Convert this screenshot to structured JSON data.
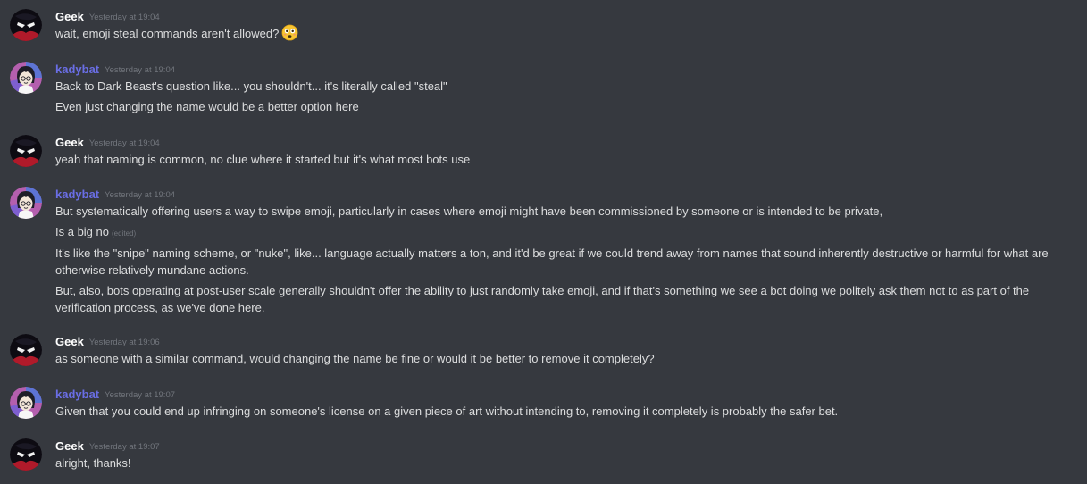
{
  "messages": [
    {
      "author": "Geek",
      "timestamp": "Yesterday at 19:04",
      "lines": [
        {
          "text": "wait, emoji steal commands aren't allowed?",
          "emoji": "flushed-face-emoji"
        }
      ]
    },
    {
      "author": "kadybat",
      "timestamp": "Yesterday at 19:04",
      "lines": [
        {
          "text": "Back to Dark Beast's question like... you shouldn't... it's literally called \"steal\""
        },
        {
          "text": "Even just changing the name would be a better option here"
        }
      ]
    },
    {
      "author": "Geek",
      "timestamp": "Yesterday at 19:04",
      "lines": [
        {
          "text": "yeah that naming is common, no clue where it started but it's what most bots use"
        }
      ]
    },
    {
      "author": "kadybat",
      "timestamp": "Yesterday at 19:04",
      "lines": [
        {
          "text": "But systematically offering users a way to swipe emoji, particularly in cases where emoji might have been commissioned by someone or is intended to be private,"
        },
        {
          "text": "Is a big no",
          "edited": "(edited)"
        },
        {
          "text": "It's like the \"snipe\" naming scheme, or \"nuke\", like... language actually matters a ton, and it'd be great if we could trend away from names that sound inherently destructive or harmful for what are otherwise relatively mundane actions."
        },
        {
          "text": "But, also, bots operating at post-user scale generally shouldn't offer the ability to just randomly take emoji, and if that's something we see a bot doing we politely ask them not to as part of the verification process, as we've done here."
        }
      ]
    },
    {
      "author": "Geek",
      "timestamp": "Yesterday at 19:06",
      "lines": [
        {
          "text": "as someone with a similar command, would changing the name be fine or would it be better to remove it completely?"
        }
      ]
    },
    {
      "author": "kadybat",
      "timestamp": "Yesterday at 19:07",
      "lines": [
        {
          "text": "Given that you could end up infringing on someone's license on a given piece of art without intending to, removing it completely is probably the safer bet."
        }
      ]
    },
    {
      "author": "Geek",
      "timestamp": "Yesterday at 19:07",
      "lines": [
        {
          "text": "alright, thanks!"
        }
      ]
    }
  ],
  "colors": {
    "background": "#36393f",
    "username_default": "#ffffff",
    "username_kadybat": "#6a6ee5",
    "timestamp": "#72767d",
    "message_text": "#dcddde"
  }
}
